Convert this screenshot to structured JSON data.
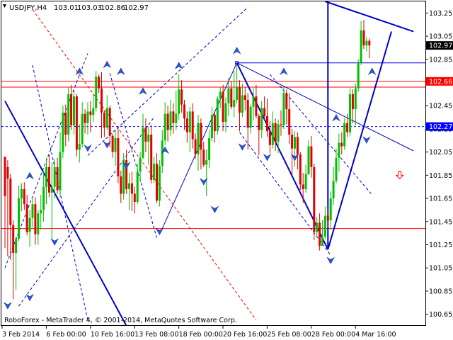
{
  "chart_data": {
    "type": "candlestick",
    "symbol": "USDJPY",
    "timeframe": "H4",
    "header_label": "USDJPY,H4",
    "header_ohlc": [
      "103.01",
      "103.03",
      "102.86",
      "102.97"
    ],
    "footer": "RoboForex - MetaTrader 4, © 2001-2014, MetaQuotes Software Corp.",
    "ylim": [
      100.55,
      103.35
    ],
    "y_ticks": [
      "103.25",
      "103.05",
      "102.85",
      "102.65",
      "102.45",
      "102.25",
      "102.05",
      "101.85",
      "101.65",
      "101.45",
      "101.25",
      "101.05",
      "100.85",
      "100.65"
    ],
    "x_ticks": [
      {
        "label": "3 Feb 2014",
        "bar": 0
      },
      {
        "label": "6 Feb 00:00",
        "bar": 16
      },
      {
        "label": "10 Feb 16:00",
        "bar": 32
      },
      {
        "label": "13 Feb 08:00",
        "bar": 48
      },
      {
        "label": "18 Feb 00:00",
        "bar": 64
      },
      {
        "label": "20 Feb 16:00",
        "bar": 80
      },
      {
        "label": "25 Feb 08:00",
        "bar": 96
      },
      {
        "label": "28 Feb 00:00",
        "bar": 112
      },
      {
        "label": "4 Mar 16:00",
        "bar": 128
      }
    ],
    "price_labels": [
      {
        "value": "103.25",
        "highlight": false
      },
      {
        "value": "102.97",
        "highlight": "current"
      },
      {
        "value": "102.66",
        "highlight": "red"
      },
      {
        "value": "102.27",
        "highlight": "blue"
      }
    ],
    "levels": [
      {
        "price": 102.66,
        "color": "#ff0000",
        "style": "solid"
      },
      {
        "price": 102.61,
        "color": "#ff0000",
        "style": "solid"
      },
      {
        "price": 102.27,
        "color": "#0000ff",
        "style": "dashed"
      },
      {
        "price": 101.39,
        "color": "#ff0000",
        "style": "solid"
      },
      {
        "price": 102.82,
        "color": "#0000ff",
        "style": "solid"
      }
    ],
    "trendlines": [
      {
        "from": [
          0,
          102.49
        ],
        "to": [
          44,
          100.55
        ],
        "color": "#0000cc",
        "width": 2
      },
      {
        "from": [
          116,
          103.35
        ],
        "to": [
          148,
          103.09
        ],
        "color": "#0000cc",
        "width": 2
      },
      {
        "from": [
          84,
          102.82
        ],
        "to": [
          148,
          102.06
        ],
        "color": "#0000cc",
        "width": 1
      },
      {
        "from": [
          84,
          102.82
        ],
        "to": [
          117,
          101.21
        ],
        "color": "#0000cc",
        "width": 2
      },
      {
        "from": [
          117,
          101.21
        ],
        "to": [
          117,
          103.35
        ],
        "color": "#0000cc",
        "width": 2
      },
      {
        "from": [
          117,
          101.21
        ],
        "to": [
          140,
          103.09
        ],
        "color": "#0000cc",
        "width": 2
      },
      {
        "from": [
          57,
          101.39
        ],
        "to": [
          84,
          102.82
        ],
        "color": "#0000cc",
        "width": 1
      }
    ],
    "dashed_lines": [
      {
        "from": [
          0,
          101.05
        ],
        "to": [
          30,
          102.9
        ],
        "color": "#0000cc"
      },
      {
        "from": [
          5,
          100.72
        ],
        "to": [
          54,
          102.35
        ],
        "color": "#0000cc"
      },
      {
        "from": [
          10,
          102.8
        ],
        "to": [
          30,
          100.6
        ],
        "color": "#0000cc"
      },
      {
        "from": [
          38,
          102.73
        ],
        "to": [
          55,
          101.31
        ],
        "color": "#0000cc"
      },
      {
        "from": [
          30,
          102.02
        ],
        "to": [
          88,
          103.3
        ],
        "color": "#0000cc"
      },
      {
        "from": [
          85,
          102.22
        ],
        "to": [
          118,
          101.16
        ],
        "color": "#0000cc"
      },
      {
        "from": [
          96,
          102.72
        ],
        "to": [
          133,
          101.68
        ],
        "color": "#0000cc"
      },
      {
        "from": [
          10,
          103.28
        ],
        "to": [
          91,
          100.6
        ],
        "color": "#ff0000"
      }
    ],
    "arrows_down": [
      [
        1,
        100.72
      ],
      [
        9,
        100.79
      ],
      [
        18,
        101.27
      ],
      [
        30,
        102.08
      ],
      [
        37,
        102.11
      ],
      [
        44,
        101.93
      ],
      [
        56,
        101.36
      ],
      [
        72,
        101.79
      ],
      [
        76,
        101.55
      ],
      [
        86,
        102.09
      ],
      [
        95,
        102.0
      ],
      [
        105,
        102.0
      ],
      [
        118,
        101.11
      ],
      [
        131,
        102.15
      ]
    ],
    "arrows_up": [
      [
        9,
        101.85
      ],
      [
        27,
        102.75
      ],
      [
        37,
        102.81
      ],
      [
        42,
        102.75
      ],
      [
        50,
        102.58
      ],
      [
        58,
        102.07
      ],
      [
        63,
        102.8
      ],
      [
        84,
        102.93
      ],
      [
        101,
        102.75
      ],
      [
        120,
        102.35
      ],
      [
        133,
        102.75
      ]
    ],
    "signal_arrow": {
      "bar": 143,
      "price": 101.85,
      "direction": "down",
      "color": "#ff0000"
    },
    "candles": [
      [
        102.01,
        101.67,
        101.92,
        101.22
      ],
      [
        101.92,
        101.82,
        101.98,
        101.15
      ],
      [
        101.82,
        101.42,
        101.86,
        101.12
      ],
      [
        101.42,
        101.18,
        101.46,
        100.78
      ],
      [
        101.18,
        101.3,
        101.32,
        100.86
      ],
      [
        101.3,
        101.65,
        101.76,
        101.28
      ],
      [
        101.65,
        101.73,
        101.78,
        101.54
      ],
      [
        101.73,
        101.6,
        101.79,
        101.55
      ],
      [
        101.6,
        101.36,
        101.68,
        101.33
      ],
      [
        101.36,
        101.48,
        101.55,
        101.23
      ],
      [
        101.48,
        101.6,
        101.65,
        101.4
      ],
      [
        101.6,
        101.34,
        101.66,
        101.25
      ],
      [
        101.34,
        101.52,
        101.55,
        101.25
      ],
      [
        101.52,
        101.55,
        101.68,
        101.38
      ],
      [
        101.55,
        101.75,
        101.88,
        101.45
      ],
      [
        101.75,
        101.92,
        102.0,
        101.6
      ],
      [
        101.92,
        101.7,
        102.03,
        101.66
      ],
      [
        101.7,
        101.75,
        101.96,
        101.3
      ],
      [
        101.75,
        101.92,
        101.99,
        101.65
      ],
      [
        101.92,
        101.72,
        102.0,
        101.69
      ],
      [
        101.72,
        102.05,
        102.22,
        101.66
      ],
      [
        102.05,
        102.39,
        102.45,
        102.0
      ],
      [
        102.39,
        102.2,
        102.46,
        102.1
      ],
      [
        102.2,
        102.55,
        102.61,
        102.14
      ],
      [
        102.55,
        102.28,
        102.63,
        102.24
      ],
      [
        102.28,
        102.53,
        102.59,
        102.2
      ],
      [
        102.53,
        102.07,
        102.55,
        102.01
      ],
      [
        102.07,
        102.12,
        102.29,
        101.96
      ],
      [
        102.12,
        102.38,
        102.48,
        102.09
      ],
      [
        102.38,
        102.3,
        102.42,
        102.21
      ],
      [
        102.3,
        102.4,
        102.48,
        102.2
      ],
      [
        102.4,
        102.37,
        102.49,
        102.22
      ],
      [
        102.37,
        102.43,
        102.55,
        102.31
      ],
      [
        102.43,
        102.7,
        102.75,
        102.4
      ],
      [
        102.7,
        102.6,
        102.72,
        102.56
      ],
      [
        102.6,
        102.39,
        102.74,
        102.17
      ],
      [
        102.39,
        102.26,
        102.41,
        102.18
      ],
      [
        102.26,
        102.43,
        102.54,
        102.24
      ],
      [
        102.43,
        102.19,
        102.45,
        102.09
      ],
      [
        102.19,
        102.05,
        102.21,
        102.0
      ],
      [
        102.05,
        102.17,
        102.24,
        101.93
      ],
      [
        102.17,
        101.84,
        102.26,
        101.78
      ],
      [
        101.84,
        101.69,
        101.89,
        101.61
      ],
      [
        101.69,
        101.98,
        102.04,
        101.64
      ],
      [
        101.98,
        101.73,
        102.07,
        101.69
      ],
      [
        101.73,
        101.78,
        101.87,
        101.55
      ],
      [
        101.78,
        101.69,
        101.88,
        101.54
      ],
      [
        101.69,
        101.62,
        101.75,
        101.52
      ],
      [
        101.62,
        101.88,
        101.95,
        101.6
      ],
      [
        101.88,
        102.0,
        102.05,
        101.79
      ],
      [
        102.0,
        102.26,
        102.38,
        101.99
      ],
      [
        102.26,
        102.14,
        102.34,
        102.05
      ],
      [
        102.14,
        102.2,
        102.27,
        101.94
      ],
      [
        102.2,
        101.81,
        102.28,
        101.78
      ],
      [
        101.81,
        101.95,
        102.01,
        101.78
      ],
      [
        101.95,
        101.63,
        102.04,
        101.61
      ],
      [
        101.63,
        101.93,
        101.98,
        101.58
      ],
      [
        101.93,
        102.15,
        102.24,
        101.87
      ],
      [
        102.15,
        102.38,
        102.48,
        102.11
      ],
      [
        102.38,
        102.24,
        102.45,
        102.14
      ],
      [
        102.24,
        102.4,
        102.5,
        102.19
      ],
      [
        102.4,
        102.3,
        102.47,
        102.21
      ],
      [
        102.3,
        102.38,
        102.58,
        102.24
      ],
      [
        102.38,
        102.59,
        102.72,
        102.33
      ],
      [
        102.59,
        102.46,
        102.67,
        102.39
      ],
      [
        102.46,
        102.34,
        102.5,
        102.24
      ],
      [
        102.34,
        102.22,
        102.4,
        102.13
      ],
      [
        102.22,
        102.4,
        102.44,
        102.05
      ],
      [
        102.4,
        102.16,
        102.47,
        102.08
      ],
      [
        102.16,
        102.03,
        102.21,
        101.99
      ],
      [
        102.03,
        102.3,
        102.37,
        101.89
      ],
      [
        102.3,
        102.07,
        102.34,
        101.9
      ],
      [
        102.07,
        101.94,
        102.14,
        101.92
      ],
      [
        101.94,
        101.98,
        102.07,
        101.67
      ],
      [
        101.98,
        102.17,
        102.24,
        101.91
      ],
      [
        102.17,
        102.37,
        102.44,
        102.14
      ],
      [
        102.37,
        102.23,
        102.39,
        102.13
      ],
      [
        102.23,
        102.51,
        102.53,
        102.2
      ],
      [
        102.51,
        102.57,
        102.61,
        102.43
      ],
      [
        102.57,
        102.31,
        102.63,
        102.23
      ],
      [
        102.31,
        102.47,
        102.52,
        102.22
      ],
      [
        102.47,
        102.6,
        102.69,
        102.36
      ],
      [
        102.6,
        102.44,
        102.66,
        102.42
      ],
      [
        102.44,
        102.5,
        102.75,
        102.35
      ],
      [
        102.5,
        102.61,
        102.8,
        102.47
      ],
      [
        102.61,
        102.39,
        102.67,
        102.23
      ],
      [
        102.39,
        102.54,
        102.64,
        102.35
      ],
      [
        102.54,
        102.5,
        102.61,
        102.41
      ],
      [
        102.5,
        102.26,
        102.56,
        102.07
      ],
      [
        102.26,
        102.44,
        102.46,
        102.21
      ],
      [
        102.44,
        102.53,
        102.6,
        102.32
      ],
      [
        102.53,
        102.36,
        102.63,
        102.34
      ],
      [
        102.36,
        102.24,
        102.38,
        102.02
      ],
      [
        102.24,
        102.43,
        102.49,
        102.17
      ],
      [
        102.43,
        102.36,
        102.53,
        102.32
      ],
      [
        102.36,
        102.23,
        102.51,
        102.18
      ],
      [
        102.23,
        102.11,
        102.32,
        102.04
      ],
      [
        102.11,
        102.3,
        102.4,
        102.08
      ],
      [
        102.3,
        102.14,
        102.34,
        102.06
      ],
      [
        102.14,
        102.29,
        102.33,
        102.04
      ],
      [
        102.29,
        102.28,
        102.41,
        102.19
      ],
      [
        102.28,
        102.56,
        102.62,
        102.25
      ],
      [
        102.56,
        102.42,
        102.59,
        102.29
      ],
      [
        102.42,
        102.2,
        102.56,
        102.12
      ],
      [
        102.2,
        102.08,
        102.25,
        101.85
      ],
      [
        102.08,
        102.18,
        102.23,
        101.92
      ],
      [
        102.18,
        102.03,
        102.22,
        101.9
      ],
      [
        102.03,
        101.77,
        102.05,
        101.72
      ],
      [
        101.77,
        101.73,
        101.87,
        101.61
      ],
      [
        101.73,
        101.86,
        101.94,
        101.7
      ],
      [
        101.86,
        102.1,
        102.15,
        101.85
      ],
      [
        102.1,
        101.92,
        102.19,
        101.83
      ],
      [
        101.92,
        101.36,
        101.95,
        101.29
      ],
      [
        101.36,
        101.44,
        101.49,
        101.31
      ],
      [
        101.44,
        101.24,
        101.52,
        101.2
      ],
      [
        101.24,
        101.32,
        101.46,
        101.24
      ],
      [
        101.32,
        101.5,
        101.58,
        101.3
      ],
      [
        101.5,
        101.46,
        101.56,
        101.4
      ],
      [
        101.46,
        101.65,
        101.71,
        101.38
      ],
      [
        101.65,
        101.8,
        101.92,
        101.59
      ],
      [
        101.8,
        102.0,
        102.08,
        101.78
      ],
      [
        102.0,
        102.13,
        102.21,
        101.88
      ],
      [
        102.13,
        102.1,
        102.22,
        102.03
      ],
      [
        102.1,
        102.3,
        102.34,
        102.07
      ],
      [
        102.3,
        102.22,
        102.38,
        102.18
      ],
      [
        102.22,
        102.55,
        102.6,
        102.19
      ],
      [
        102.55,
        102.42,
        102.59,
        102.3
      ],
      [
        102.42,
        102.6,
        102.64,
        102.28
      ],
      [
        102.6,
        102.82,
        102.85,
        102.57
      ],
      [
        102.82,
        103.1,
        103.18,
        102.8
      ],
      [
        103.1,
        102.97,
        103.19,
        102.94
      ],
      [
        102.97,
        103.01,
        103.04,
        102.92
      ],
      [
        103.01,
        102.97,
        103.03,
        102.86
      ]
    ]
  }
}
